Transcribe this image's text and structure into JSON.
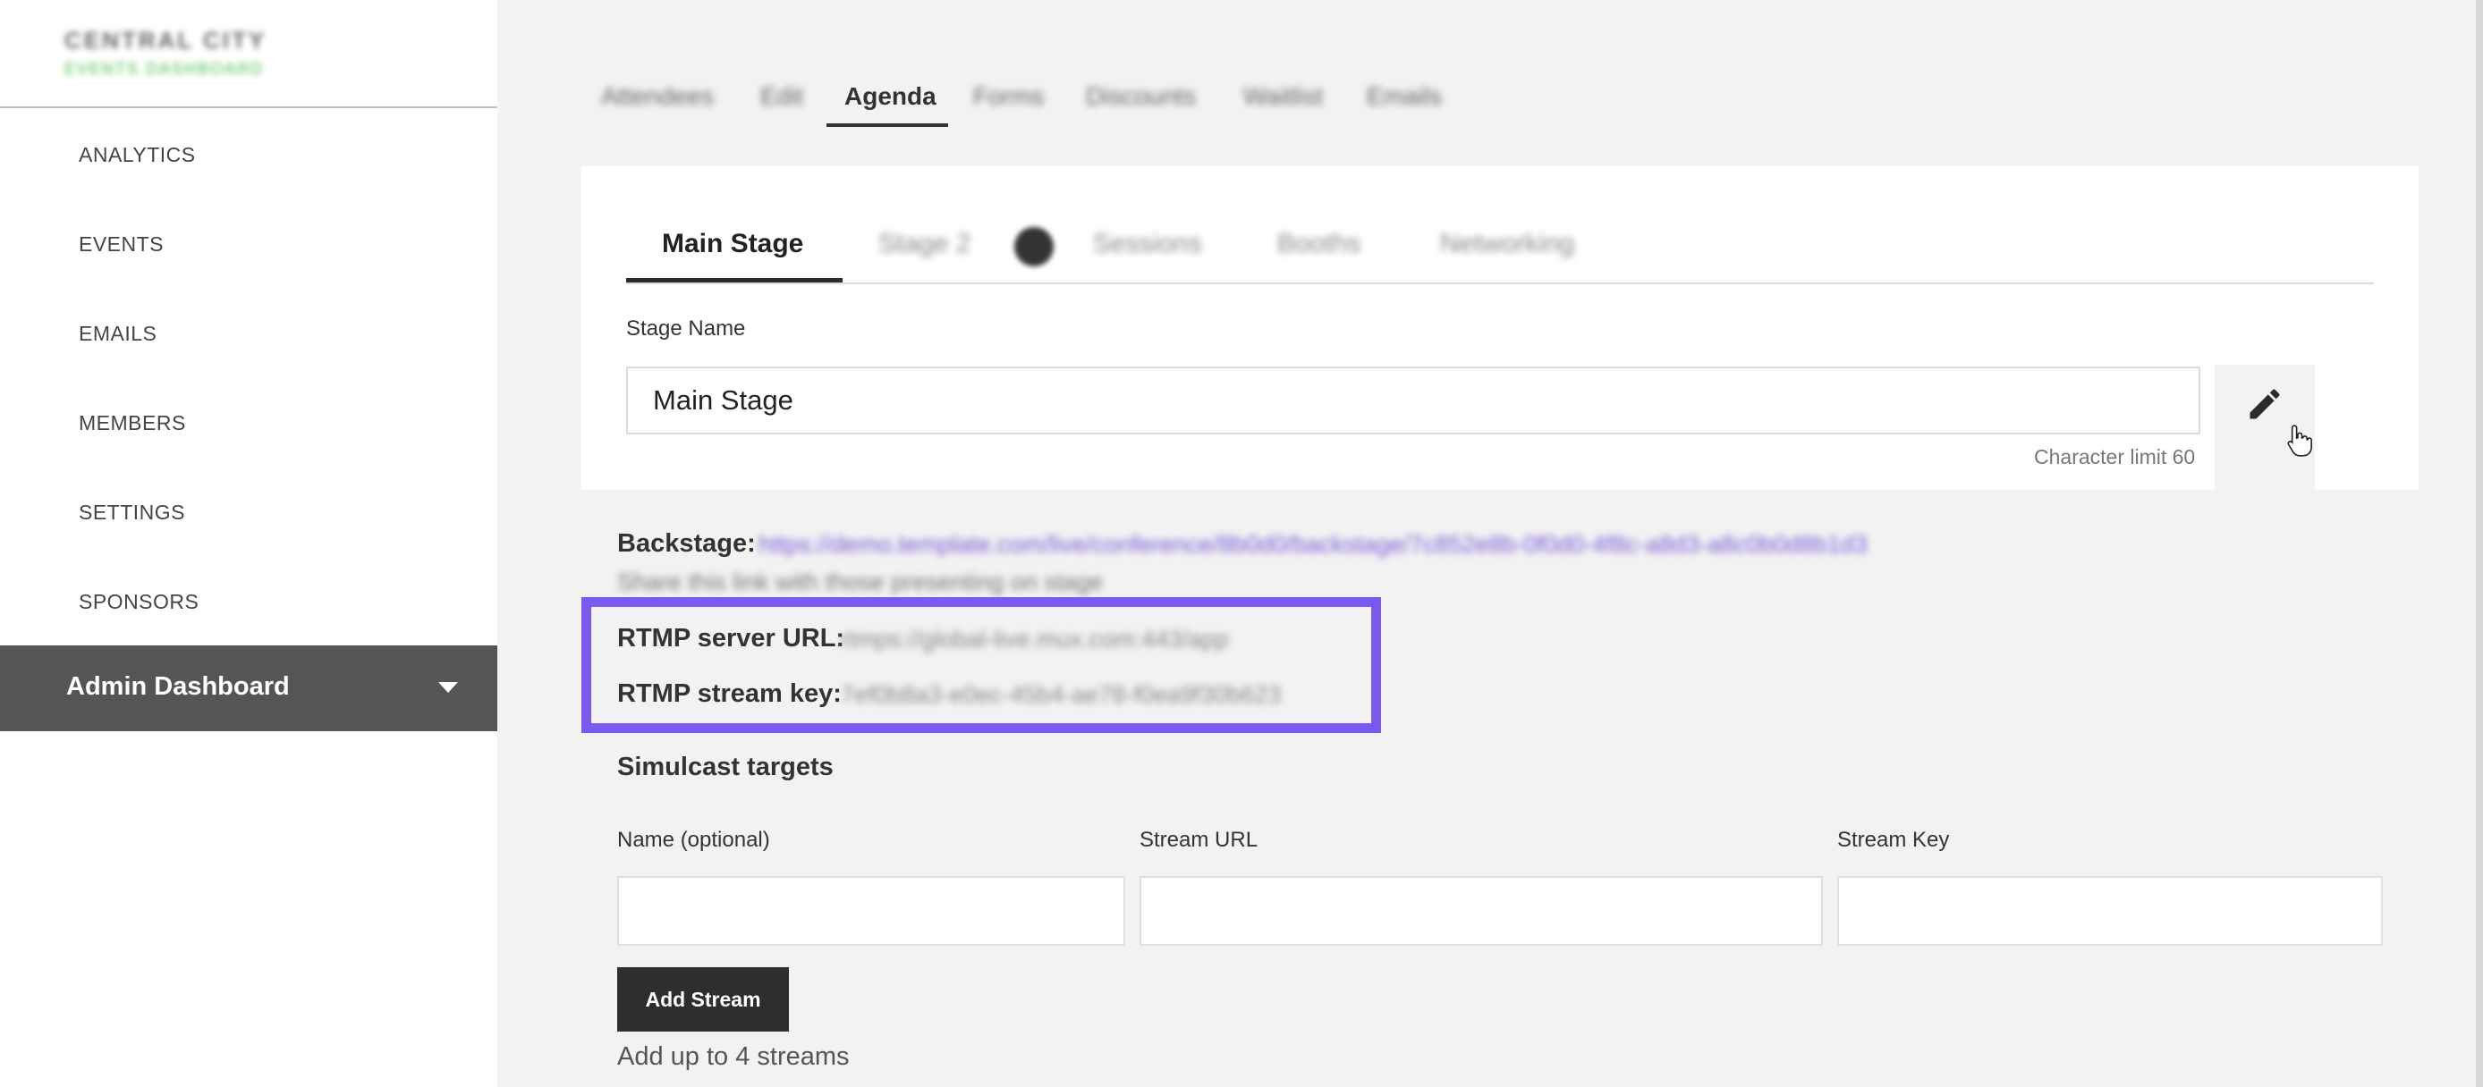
{
  "sidebar": {
    "logo_line1": "CENTRAL CITY",
    "logo_line2": "EVENTS DASHBOARD",
    "items": [
      {
        "label": "ANALYTICS"
      },
      {
        "label": "EVENTS"
      },
      {
        "label": "EMAILS"
      },
      {
        "label": "MEMBERS"
      },
      {
        "label": "SETTINGS"
      },
      {
        "label": "SPONSORS"
      }
    ],
    "admin_label": "Admin Dashboard"
  },
  "top_tabs": [
    {
      "label": "Attendees"
    },
    {
      "label": "Edit"
    },
    {
      "label": "Agenda"
    },
    {
      "label": "Forms"
    },
    {
      "label": "Discounts"
    },
    {
      "label": "Waitlist"
    },
    {
      "label": "Emails"
    }
  ],
  "stage_tabs": [
    {
      "label": "Main Stage"
    },
    {
      "label": "Stage 2"
    },
    {
      "label": "Sessions"
    },
    {
      "label": "Booths"
    },
    {
      "label": "Networking"
    }
  ],
  "stage_name": {
    "label": "Stage Name",
    "value": "Main Stage",
    "char_limit": "Character limit 60"
  },
  "backstage": {
    "label": "Backstage:",
    "url": "https://demo.template.com/live/conference/8b0d0/backstage/7c852e8b-0f0d0-4f8c-a8d3-a8c0b0d8b1d3",
    "note": "Share this link with those presenting on stage"
  },
  "rtmp": {
    "server_label": "RTMP server URL:",
    "server_value": "rtmps://global-live.mux.com:443/app",
    "key_label": "RTMP stream key:",
    "key_value": "7ef0b8a3-e0ec-45b4-ae78-f0ea9f30b623"
  },
  "simulcast": {
    "title": "Simulcast targets",
    "name_label": "Name (optional)",
    "url_label": "Stream URL",
    "key_label": "Stream Key",
    "button_label": "Add Stream",
    "helper": "Add up to 4 streams"
  },
  "colors": {
    "highlight": "#7a59ef",
    "admin_bar": "#555555",
    "button": "#2e2e2e"
  }
}
